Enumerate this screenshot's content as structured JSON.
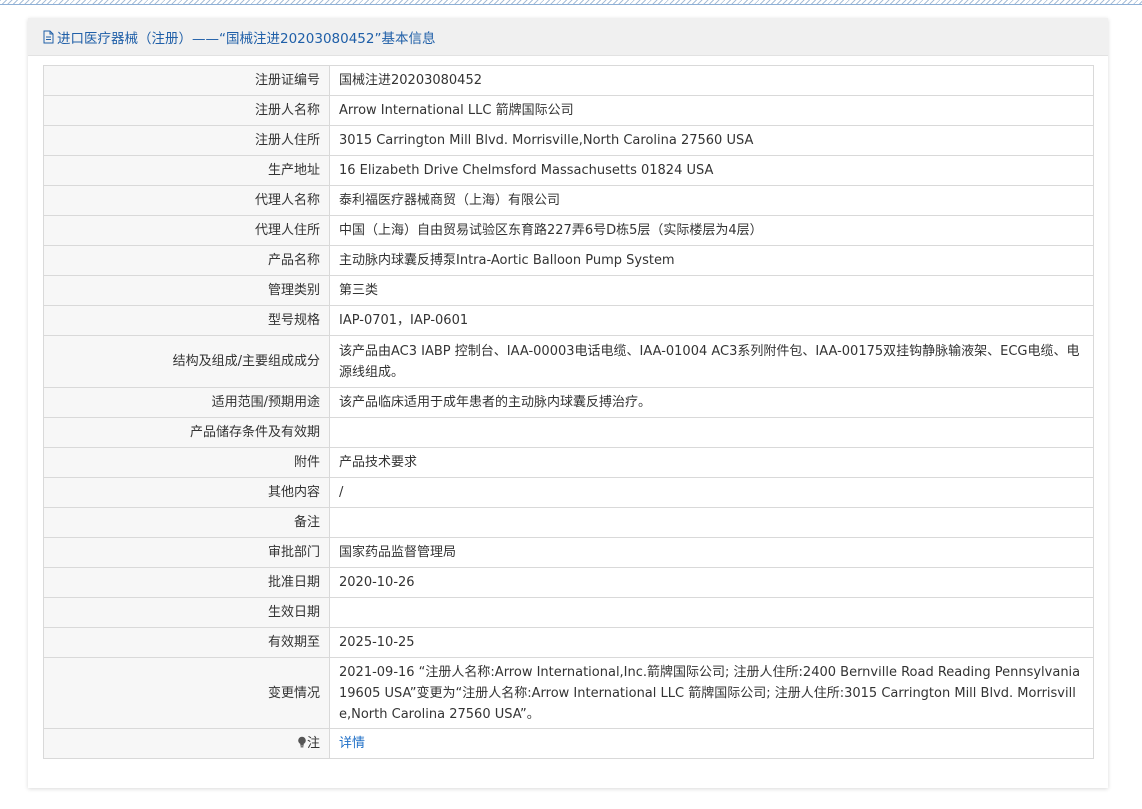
{
  "header": {
    "title": "进口医疗器械（注册）——“国械注进20203080452”基本信息",
    "icon": "document-icon"
  },
  "rows": [
    {
      "label": "注册证编号",
      "value": "国械注进20203080452"
    },
    {
      "label": "注册人名称",
      "value": "Arrow International LLC 箭牌国际公司"
    },
    {
      "label": "注册人住所",
      "value": "3015 Carrington Mill Blvd. Morrisville,North Carolina 27560 USA"
    },
    {
      "label": "生产地址",
      "value": "16 Elizabeth Drive Chelmsford Massachusetts 01824 USA"
    },
    {
      "label": "代理人名称",
      "value": "泰利福医疗器械商贸（上海）有限公司"
    },
    {
      "label": "代理人住所",
      "value": "中国（上海）自由贸易试验区东育路227弄6号D栋5层（实际楼层为4层）"
    },
    {
      "label": "产品名称",
      "value": "主动脉内球囊反搏泵Intra-Aortic Balloon Pump System"
    },
    {
      "label": "管理类别",
      "value": "第三类"
    },
    {
      "label": "型号规格",
      "value": "IAP-0701，IAP-0601"
    },
    {
      "label": "结构及组成/主要组成成分",
      "value": "该产品由AC3 IABP 控制台、IAA-00003电话电缆、IAA-01004 AC3系列附件包、IAA-00175双挂钩静脉输液架、ECG电缆、电源线组成。"
    },
    {
      "label": "适用范围/预期用途",
      "value": "该产品临床适用于成年患者的主动脉内球囊反搏治疗。"
    },
    {
      "label": "产品储存条件及有效期",
      "value": ""
    },
    {
      "label": "附件",
      "value": "产品技术要求"
    },
    {
      "label": "其他内容",
      "value": "/"
    },
    {
      "label": "备注",
      "value": ""
    },
    {
      "label": "审批部门",
      "value": "国家药品监督管理局"
    },
    {
      "label": "批准日期",
      "value": "2020-10-26"
    },
    {
      "label": "生效日期",
      "value": ""
    },
    {
      "label": "有效期至",
      "value": "2025-10-25"
    },
    {
      "label": "变更情况",
      "value": "2021-09-16 “注册人名称:Arrow International,Inc.箭牌国际公司; 注册人住所:2400 Bernville Road Reading Pennsylvania 19605 USA”变更为“注册人名称:Arrow International LLC 箭牌国际公司; 注册人住所:3015 Carrington Mill Blvd. Morrisville,North Carolina 27560 USA”。"
    }
  ],
  "note": {
    "label": "注",
    "icon": "lightbulb-icon",
    "link_text": "详情"
  }
}
